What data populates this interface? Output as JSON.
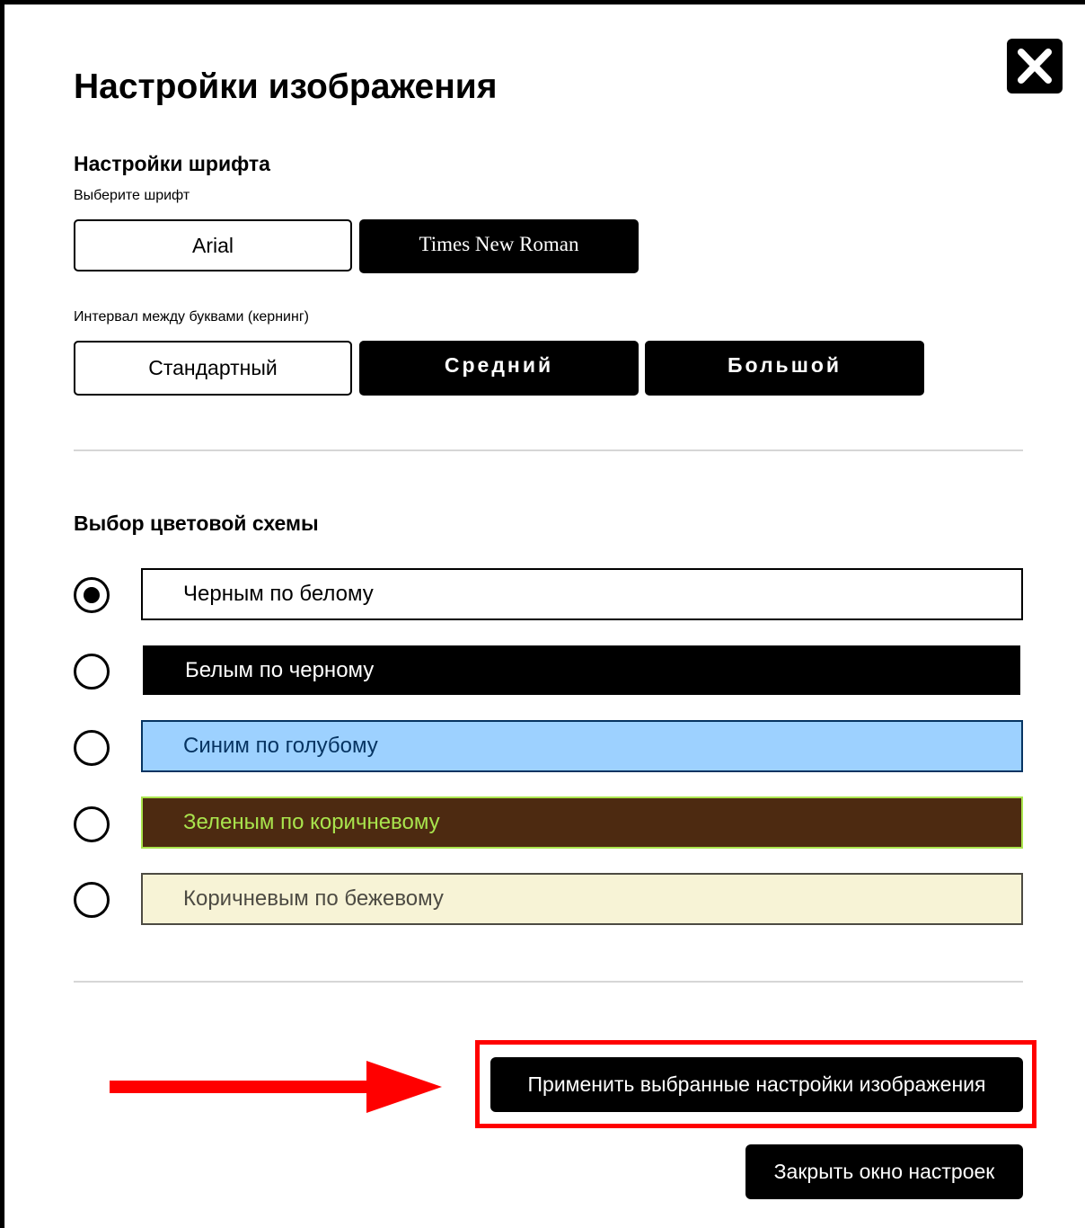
{
  "dialog": {
    "title": "Настройки изображения"
  },
  "font_settings": {
    "heading": "Настройки шрифта",
    "font_label": "Выберите шрифт",
    "fonts": [
      "Arial",
      "Times New Roman"
    ],
    "selected_font": "Arial",
    "kerning_label": "Интервал между буквами (кернинг)",
    "kerning_options": [
      "Стандартный",
      "Средний",
      "Большой"
    ],
    "selected_kerning": "Стандартный"
  },
  "color_scheme": {
    "heading": "Выбор цветовой схемы",
    "options": [
      {
        "label": "Черным по белому",
        "text_color": "#000000",
        "bg_color": "#ffffff",
        "border_color": "#000000",
        "selected": true
      },
      {
        "label": "Белым по черному",
        "text_color": "#ffffff",
        "bg_color": "#000000",
        "border_color": "#000000",
        "selected": false
      },
      {
        "label": "Синим по голубому",
        "text_color": "#063462",
        "bg_color": "#9dd1ff",
        "border_color": "#063462",
        "selected": false
      },
      {
        "label": "Зеленым по коричневому",
        "text_color": "#a9e44d",
        "bg_color": "#4d2a11",
        "border_color": "#a9e44d",
        "selected": false
      },
      {
        "label": "Коричневым по бежевому",
        "text_color": "#4d4b43",
        "bg_color": "#f7f3d6",
        "border_color": "#4d4b43",
        "selected": false
      }
    ]
  },
  "actions": {
    "apply_label": "Применить выбранные настройки изображения",
    "close_label": "Закрыть окно настроек"
  },
  "annotation": {
    "highlight_color": "#ff0000"
  },
  "icons": {
    "close": "close-icon",
    "arrow": "arrow-right-icon"
  }
}
